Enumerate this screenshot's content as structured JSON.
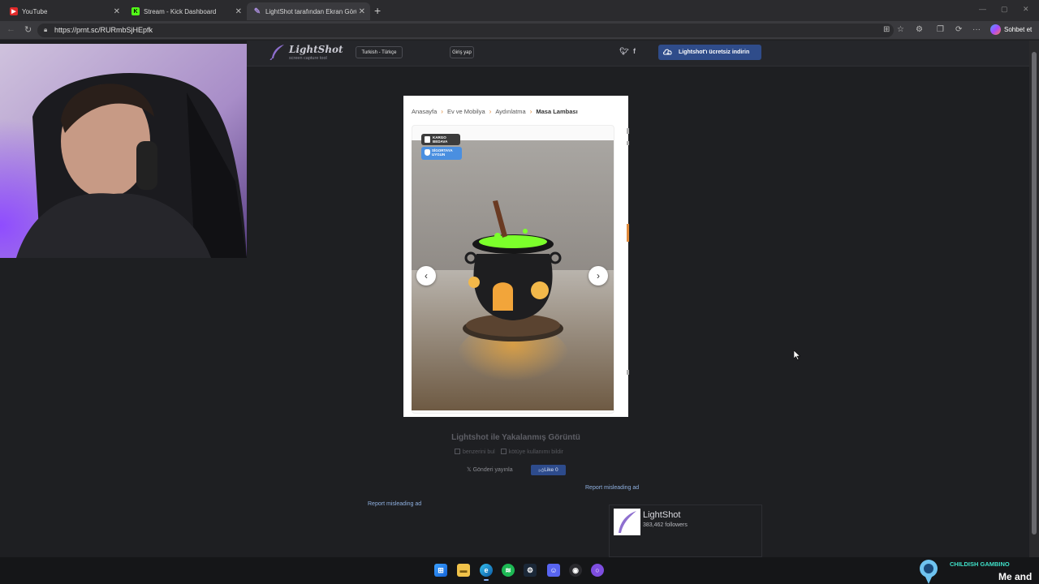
{
  "browser": {
    "tabs": [
      {
        "label": "YouTube",
        "favicon_color": "#e02a2a",
        "active": false
      },
      {
        "label": "Stream - Kick Dashboard",
        "favicon_color": "#53fc18",
        "active": false
      },
      {
        "label": "LightShot tarafından Ekran Görüntü",
        "favicon_color": "#a78bd8",
        "active": true
      }
    ],
    "url": "https://prnt.sc/RURmbSjHEpfk",
    "chat_button": "Sohbet et"
  },
  "lightshot": {
    "logo": "LightShot",
    "tagline": "screen capture tool",
    "language": "Turkish - Türkçe",
    "login": "Giriş yap",
    "social": [
      "twitter-icon",
      "facebook-icon"
    ],
    "download": "Lightshot'ı ücretsiz indirin"
  },
  "screenshot": {
    "breadcrumb": [
      "Anasayfa",
      "Ev ve Mobilya",
      "Aydınlatma",
      "Masa Lambası"
    ],
    "badge_cargo": [
      "KARGO",
      "BEDAVA"
    ],
    "badge_insurance": [
      "SİGORTAYA",
      "UYGUN"
    ],
    "prev": "‹",
    "next": "›"
  },
  "page": {
    "caption": "Lightshot ile Yakalanmış Görüntü",
    "similar": "benzerini bul",
    "abuse": "kötüye kullanımı bildir",
    "share": "Gönderi yayınla",
    "like": "Like 0",
    "report_ad": "Report misleading ad",
    "widget_name": "LightShot",
    "widget_followers": "383,462 followers"
  },
  "nowplaying": {
    "artist": "CHILDISH GAMBINO",
    "song": "Me and"
  },
  "colors": {
    "page_bg": "#1e1f22",
    "download_btn": "#2f4c8a",
    "breadcrumb_sep": "#e0893a",
    "cauldron_glow": "#7cff2b",
    "link": "#8fb0e0"
  }
}
